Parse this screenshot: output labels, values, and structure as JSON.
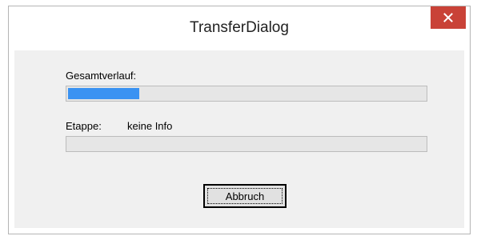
{
  "window": {
    "title": "TransferDialog",
    "close_icon": "close-icon"
  },
  "overall": {
    "label": "Gesamtverlauf:",
    "progress": 0.2
  },
  "stage": {
    "label": "Etappe:",
    "info": "keine Info",
    "progress": 0
  },
  "buttons": {
    "cancel_label": "Abbruch"
  },
  "colors": {
    "close": "#c94237",
    "progress": "#3a92f2"
  }
}
